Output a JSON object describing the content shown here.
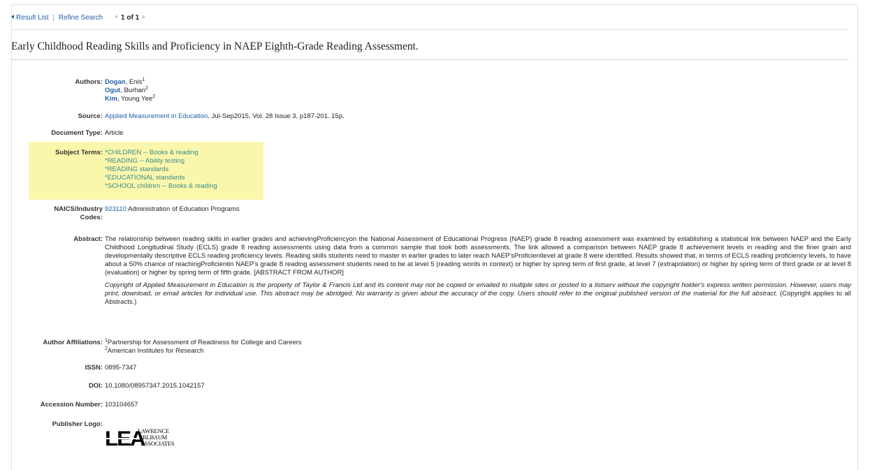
{
  "nav": {
    "result_list": "Result List",
    "separator": "|",
    "refine_search": "Refine Search",
    "pager_text": "1 of 1"
  },
  "record": {
    "title": "Early Childhood Reading Skills and Proficiency in NAEP Eighth-Grade Reading Assessment.",
    "labels": {
      "authors": "Authors:",
      "source": "Source:",
      "document_type": "Document Type:",
      "subject_terms": "Subject Terms:",
      "naics_line1": "NAICS/Industry",
      "naics_line2": "Codes:",
      "abstract": "Abstract:",
      "author_affiliations": "Author Affiliations:",
      "issn": "ISSN:",
      "doi": "DOI:",
      "accession_number": "Accession Number:",
      "publisher_logo": "Publisher Logo:"
    },
    "authors": [
      {
        "last": "Dogan",
        "first": ", Enis",
        "sup": "1"
      },
      {
        "last": "Ogut",
        "first": ", Burhan",
        "sup": "2"
      },
      {
        "last": "Kim",
        "first": ", Young Yee",
        "sup": "2"
      }
    ],
    "source": {
      "journal": "Applied Measurement in Education",
      "details": ". Jul-Sep2015, Vol. 28 Issue 3, p187-201. 15p."
    },
    "document_type": "Article",
    "subject_terms": [
      "*CHILDREN -- Books & reading",
      "*READING -- Ability testing",
      "*READING standards",
      "*EDUCATIONAL standards",
      "*SCHOOL children -- Books & reading"
    ],
    "naics": {
      "code": "923110",
      "description": "Administration of Education Programs"
    },
    "abstract": "The relationship between reading skills in earlier grades and achievingProficiencyon the National Assessment of Educational Progress (NAEP) grade 8 reading assessment was examined by establishing a statistical link between NAEP and the Early Childhood Longitudinal Study (ECLS) grade 8 reading assessments using data from a common sample that took both assessments. The link allowed a comparison between NAEP grade 8 achievement levels in reading and the finer grain and developmentally descriptive ECLS reading proficiency levels. Reading skills students need to master in earlier grades to later reach NAEP'sProficientlevel at grade 8 were identified. Results showed that, in terms of ECLS reading proficiency levels, to have about a 50% chance of reachingProficientin NAEP's grade 8 reading assessment students need to be at level 5 (reading words in context) or higher by spring term of first grade, at level 7 (extrapolation) or higher by spring term of third grade or at level 8 (evaluation) or higher by spring term of fifth grade. [ABSTRACT FROM AUTHOR]",
    "copyright_italic": "Copyright of Applied Measurement in Education is the property of Taylor & Francis Ltd and its content may not be copied or emailed to multiple sites or posted to a listserv without the copyright holder's express written permission. However, users may print, download, or email articles for individual use. This abstract may be abridged. No warranty is given about the accuracy of the copy. Users should refer to the original published version of the material for the full abstract.",
    "copyright_plain": " (Copyright applies to all Abstracts.)",
    "affiliations": [
      {
        "sup": "1",
        "text": "Partnership for Assessment of Readiness for College and Careers"
      },
      {
        "sup": "2",
        "text": "American Institutes for Research"
      }
    ],
    "issn": "0895-7347",
    "doi": "10.1080/08957347.2015.1042157",
    "accession_number": "103104657",
    "publisher_logo": {
      "mark": "LEA",
      "line1": "LAWRENCE",
      "line2": "ERLBAUM",
      "line3": "ASSOCIATES"
    }
  },
  "colors": {
    "link": "#1f5ea8",
    "subject_link": "#3a8a86",
    "highlight": "#faf7ad"
  }
}
